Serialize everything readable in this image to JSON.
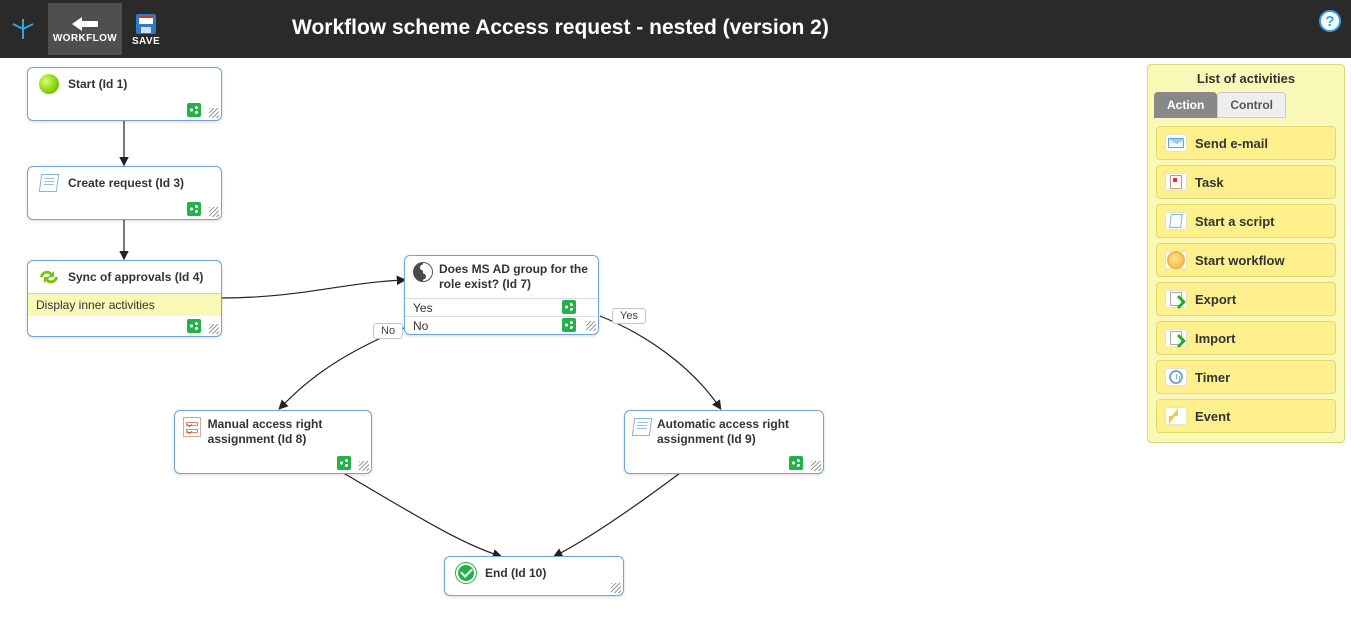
{
  "toolbar": {
    "workflow_label": "WORKFLOW",
    "save_label": "SAVE",
    "title": "Workflow scheme Access request - nested (version 2)"
  },
  "nodes": {
    "start": {
      "title": "Start (Id 1)"
    },
    "create_request": {
      "title": "Create request (Id 3)"
    },
    "sync_approvals": {
      "title": "Sync of approvals (Id 4)",
      "sub": "Display inner activities"
    },
    "ad_group": {
      "title": "Does MS AD group for the role exist? (Id 7)",
      "yes": "Yes",
      "no": "No"
    },
    "manual": {
      "title": "Manual access right assignment (Id 8)"
    },
    "auto": {
      "title": "Automatic access right assignment (Id 9)"
    },
    "end": {
      "title": "End (Id 10)"
    }
  },
  "branch_labels": {
    "no": "No",
    "yes": "Yes"
  },
  "sidebar": {
    "title": "List of activities",
    "tabs": {
      "action": "Action",
      "control": "Control"
    },
    "items": [
      {
        "label": "Send e-mail"
      },
      {
        "label": "Task"
      },
      {
        "label": "Start a script"
      },
      {
        "label": "Start workflow"
      },
      {
        "label": "Export"
      },
      {
        "label": "Import"
      },
      {
        "label": "Timer"
      },
      {
        "label": "Event"
      }
    ]
  }
}
